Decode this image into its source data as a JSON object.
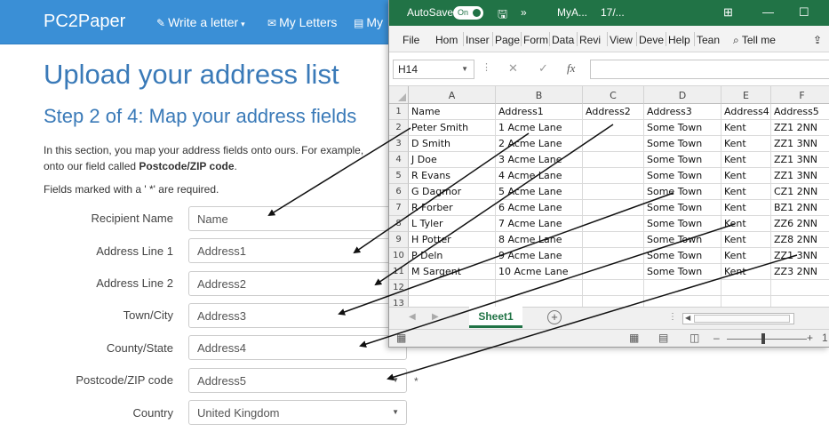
{
  "site": {
    "brand": "PC2Paper",
    "nav": [
      {
        "label": "Write a letter",
        "icon": "pencil-icon",
        "has_caret": true
      },
      {
        "label": "My Letters",
        "icon": "envelope-icon",
        "has_caret": false
      },
      {
        "label": "My",
        "icon": "document-icon",
        "has_caret": false
      }
    ],
    "heading": "Upload your address list",
    "step_heading": "Step 2 of 4: Map your address fields",
    "intro_line1": "In this section, you map your address fields onto ours. For example,",
    "intro_line2_pre": "onto our field called ",
    "intro_line2_bold": "Postcode/ZIP code",
    "intro_line2_post": ".",
    "required_note": "Fields marked with a ' *' are required.",
    "fields": [
      {
        "label": "Recipient Name",
        "value": "Name"
      },
      {
        "label": "Address Line 1",
        "value": "Address1"
      },
      {
        "label": "Address Line 2",
        "value": "Address2"
      },
      {
        "label": "Town/City",
        "value": "Address3"
      },
      {
        "label": "County/State",
        "value": "Address4"
      },
      {
        "label": "Postcode/ZIP code",
        "value": "Address5"
      },
      {
        "label": "Country",
        "value": "United Kingdom"
      }
    ],
    "required_marker": "*"
  },
  "excel": {
    "autosave_label": "AutoSave",
    "autosave_state": "On",
    "file_title": "MyA...",
    "file_date": "17/...",
    "menu": [
      "File",
      "Hom",
      "Inser",
      "Page",
      "Form",
      "Data",
      "Revi",
      "View",
      "Deve",
      "Help",
      "Tean"
    ],
    "tell_me": "Tell me",
    "name_box": "H14",
    "fx_label": "fx",
    "columns": [
      "A",
      "B",
      "C",
      "D",
      "E",
      "F"
    ],
    "rows": [
      [
        "Name",
        "Address1",
        "Address2",
        "Address3",
        "Address4",
        "Address5"
      ],
      [
        "Peter Smith",
        "1 Acme Lane",
        "",
        "Some Town",
        "Kent",
        "ZZ1 2NN"
      ],
      [
        "D Smith",
        "2 Acme Lane",
        "",
        "Some Town",
        "Kent",
        "ZZ1 3NN"
      ],
      [
        "J Doe",
        "3 Acme Lane",
        "",
        "Some Town",
        "Kent",
        "ZZ1 3NN"
      ],
      [
        "R Evans",
        "4 Acme Lane",
        "",
        "Some Town",
        "Kent",
        "ZZ1 3NN"
      ],
      [
        "G Dagmor",
        "5 Acme Lane",
        "",
        "Some Town",
        "Kent",
        "CZ1 2NN"
      ],
      [
        "R Forber",
        "6 Acme Lane",
        "",
        "Some Town",
        "Kent",
        "BZ1 2NN"
      ],
      [
        "L Tyler",
        "7 Acme Lane",
        "",
        "Some Town",
        "Kent",
        "ZZ6 2NN"
      ],
      [
        "H Potter",
        "8 Acme Lane",
        "",
        "Some Town",
        "Kent",
        "ZZ8 2NN"
      ],
      [
        "P Deln",
        "9 Acme Lane",
        "",
        "Some Town",
        "Kent",
        "ZZ1 3NN"
      ],
      [
        "M Sargent",
        "10 Acme Lane",
        "",
        "Some Town",
        "Kent",
        "ZZ3 2NN"
      ],
      [
        "",
        "",
        "",
        "",
        "",
        ""
      ],
      [
        "",
        "",
        "",
        "",
        "",
        ""
      ]
    ],
    "row_numbers": [
      "1",
      "2",
      "3",
      "4",
      "5",
      "6",
      "7",
      "8",
      "9",
      "10",
      "11",
      "12",
      "13"
    ],
    "sheet_tab": "Sheet1",
    "zoom_plus": "+",
    "zoom_text": "1"
  },
  "colors": {
    "navbar": "#3a8fd6",
    "heading": "#3a7ab8",
    "excel_green": "#217346"
  }
}
